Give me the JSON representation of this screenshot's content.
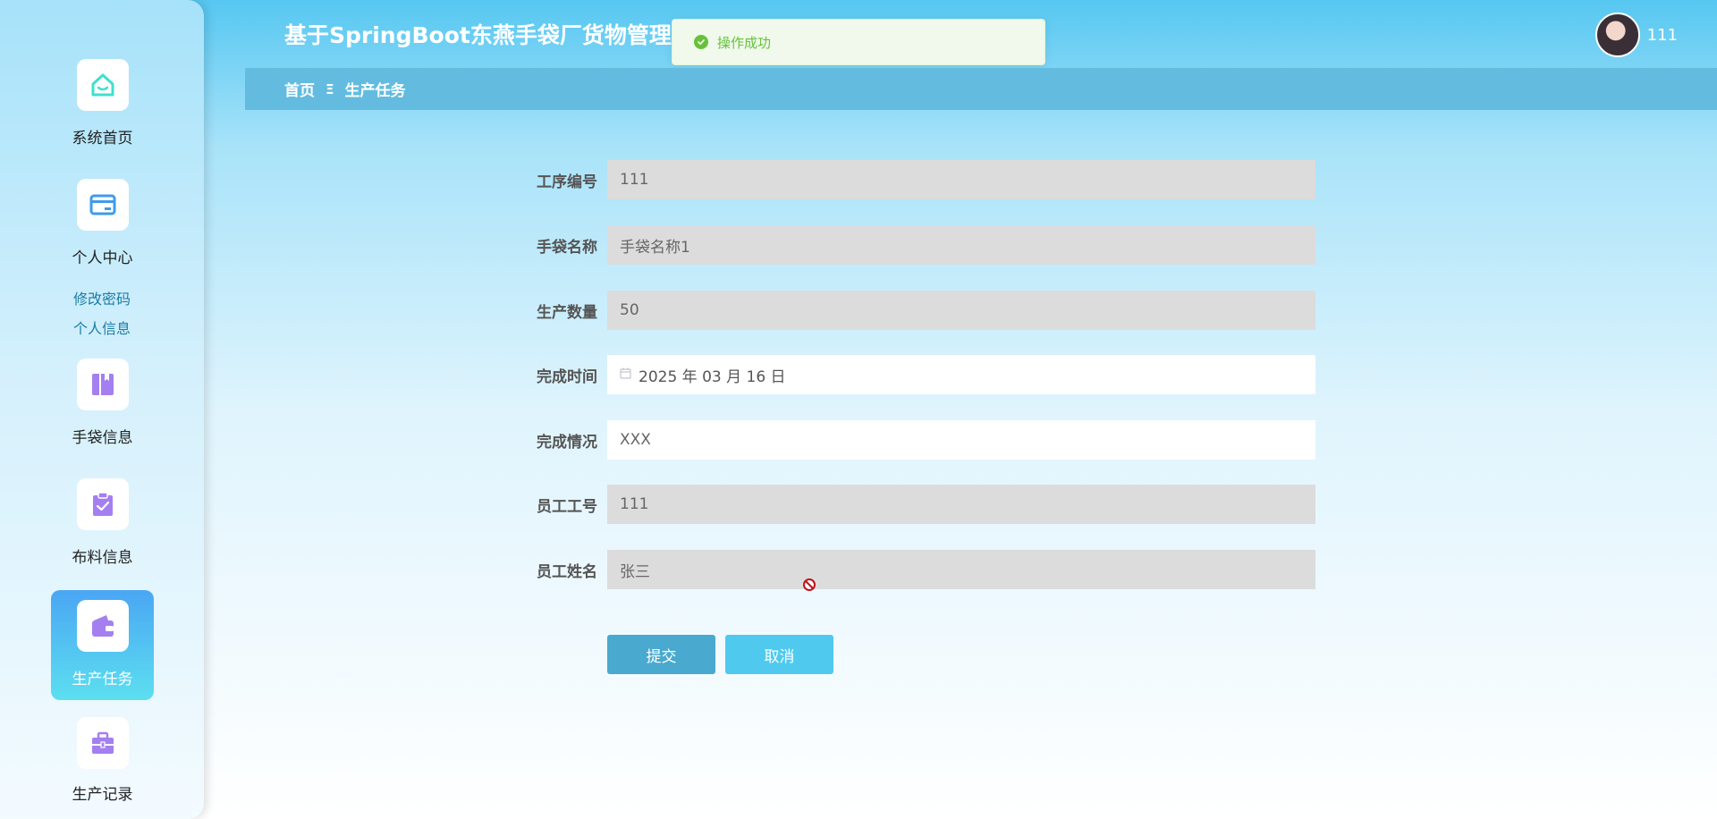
{
  "header": {
    "site_title": "基于SpringBoot东燕手袋厂货物管理",
    "username": "111"
  },
  "toast": {
    "message": "操作成功",
    "icon": "success-check-icon",
    "color": "#67c23a"
  },
  "sidebar": {
    "items": [
      {
        "label": "系统首页",
        "icon": "home-icon"
      },
      {
        "label": "个人中心",
        "icon": "id-card-icon",
        "submenu": [
          "修改密码",
          "个人信息"
        ]
      },
      {
        "label": "手袋信息",
        "icon": "book-icon"
      },
      {
        "label": "布料信息",
        "icon": "clipboard-check-icon"
      },
      {
        "label": "生产任务",
        "icon": "wallet-icon",
        "active": true
      },
      {
        "label": "生产记录",
        "icon": "briefcase-icon"
      }
    ]
  },
  "breadcrumb": {
    "home": "首页",
    "separator": "Ξ",
    "current": "生产任务"
  },
  "form": {
    "fields": [
      {
        "label": "工序编号",
        "value": "111",
        "editable": false
      },
      {
        "label": "手袋名称",
        "value": "手袋名称1",
        "editable": false
      },
      {
        "label": "生产数量",
        "value": "50",
        "editable": false
      },
      {
        "label": "完成时间",
        "value": "2025 年 03 月 16 日",
        "editable": true,
        "type": "date"
      },
      {
        "label": "完成情况",
        "value": "XXX",
        "editable": true
      },
      {
        "label": "员工工号",
        "value": "111",
        "editable": false
      },
      {
        "label": "员工姓名",
        "value": "张三",
        "editable": false
      }
    ],
    "submit_label": "提交",
    "cancel_label": "取消"
  },
  "colors": {
    "accent": "#4aa9cf",
    "breadcrumb_bg": "#63bcdf",
    "active_menu": "#4aa6f3",
    "icon_color": "#a47ff0"
  }
}
